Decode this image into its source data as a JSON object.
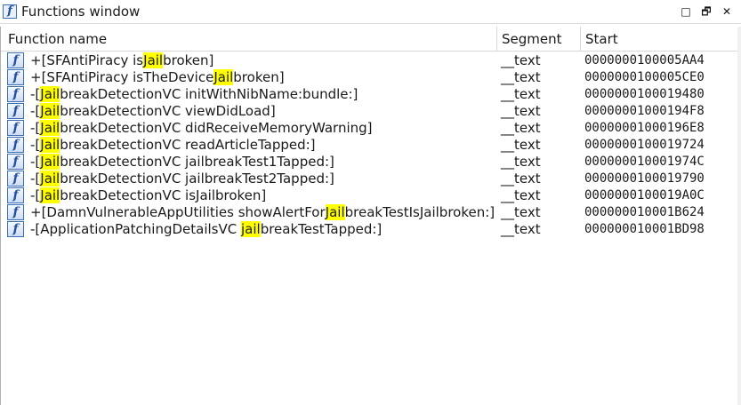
{
  "window": {
    "title": "Functions window",
    "icon_glyph": "f",
    "controls": {
      "restore": "□",
      "maximize": "🗗",
      "close": "✕"
    }
  },
  "columns": {
    "name": "Function name",
    "segment": "Segment",
    "start": "Start"
  },
  "rows": [
    {
      "pre": "+[SFAntiPiracy is",
      "hl": "Jail",
      "post": "broken]",
      "segment": "__text",
      "start": "0000000100005AA4"
    },
    {
      "pre": "+[SFAntiPiracy isTheDevice",
      "hl": "Jail",
      "post": "broken]",
      "segment": "__text",
      "start": "0000000100005CE0"
    },
    {
      "pre": "-[",
      "hl": "Jail",
      "post": "breakDetectionVC initWithNibName:bundle:]",
      "segment": "__text",
      "start": "0000000100019480"
    },
    {
      "pre": "-[",
      "hl": "Jail",
      "post": "breakDetectionVC viewDidLoad]",
      "segment": "__text",
      "start": "00000001000194F8"
    },
    {
      "pre": "-[",
      "hl": "Jail",
      "post": "breakDetectionVC didReceiveMemoryWarning]",
      "segment": "__text",
      "start": "00000001000196E8"
    },
    {
      "pre": "-[",
      "hl": "Jail",
      "post": "breakDetectionVC readArticleTapped:]",
      "segment": "__text",
      "start": "0000000100019724"
    },
    {
      "pre": "-[",
      "hl": "Jail",
      "post": "breakDetectionVC jailbreakTest1Tapped:]",
      "segment": "__text",
      "start": "000000010001974C"
    },
    {
      "pre": "-[",
      "hl": "Jail",
      "post": "breakDetectionVC jailbreakTest2Tapped:]",
      "segment": "__text",
      "start": "0000000100019790"
    },
    {
      "pre": "-[",
      "hl": "Jail",
      "post": "breakDetectionVC isJailbroken]",
      "segment": "__text",
      "start": "0000000100019A0C"
    },
    {
      "pre": "+[DamnVulnerableAppUtilities showAlertFor",
      "hl": "Jail",
      "post": "breakTestIsJailbroken:]",
      "segment": "__text",
      "start": "000000010001B624"
    },
    {
      "pre": "-[ApplicationPatchingDetailsVC ",
      "hl": "jail",
      "post": "breakTestTapped:]",
      "segment": "__text",
      "start": "000000010001BD98"
    }
  ],
  "colors": {
    "highlight": "#ffff00",
    "icon_border": "#3b6fb5"
  }
}
